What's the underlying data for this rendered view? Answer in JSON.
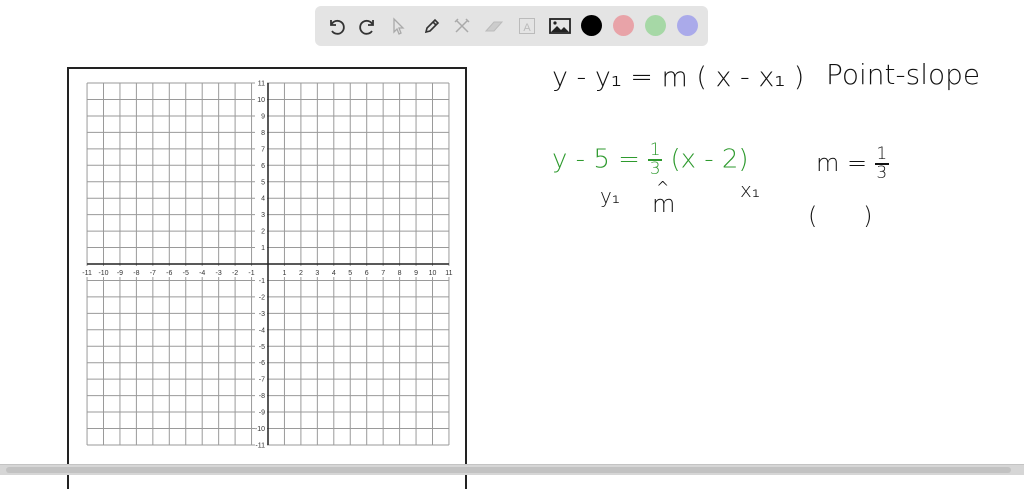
{
  "toolbar": {
    "tools": [
      "undo-icon",
      "redo-icon",
      "select-icon",
      "pen-icon",
      "tools-icon",
      "eraser-icon",
      "text-icon",
      "image-icon"
    ],
    "colors": [
      {
        "name": "black",
        "hex": "#000000"
      },
      {
        "name": "pink",
        "hex": "#e8a3a8"
      },
      {
        "name": "green",
        "hex": "#a6d8a6"
      },
      {
        "name": "purple",
        "hex": "#aaaaea"
      }
    ]
  },
  "graph": {
    "x_ticks": [
      "-11",
      "-10",
      "-9",
      "-8",
      "-7",
      "-6",
      "-5",
      "-4",
      "-3",
      "-2",
      "-1",
      "1",
      "2",
      "3",
      "4",
      "5",
      "6",
      "7",
      "8",
      "9",
      "10",
      "11"
    ],
    "y_ticks": [
      "11",
      "10",
      "9",
      "8",
      "7",
      "6",
      "5",
      "4",
      "3",
      "2",
      "1",
      "-1",
      "-2",
      "-3",
      "-4",
      "-5",
      "-6",
      "-7",
      "-8",
      "-9",
      "-10",
      "-11"
    ]
  },
  "notes": {
    "formula": "y - y₁ = m ( x - x₁ )",
    "formula_label": "Point-slope",
    "example_lhs": "y - ",
    "example_y1": "5",
    "example_eq": " = ",
    "example_m_num": "1",
    "example_m_den": "3",
    "example_rest": " (x - 2)",
    "label_y1": "y₁",
    "label_m_arrow": "^",
    "label_m": "m",
    "label_x1": "x₁",
    "slope_lhs": "m = ",
    "slope_num": "1",
    "slope_den": "3",
    "point_parens": "(      )"
  },
  "colors": {
    "ink": "#111111",
    "green": "#2e9a2e"
  }
}
